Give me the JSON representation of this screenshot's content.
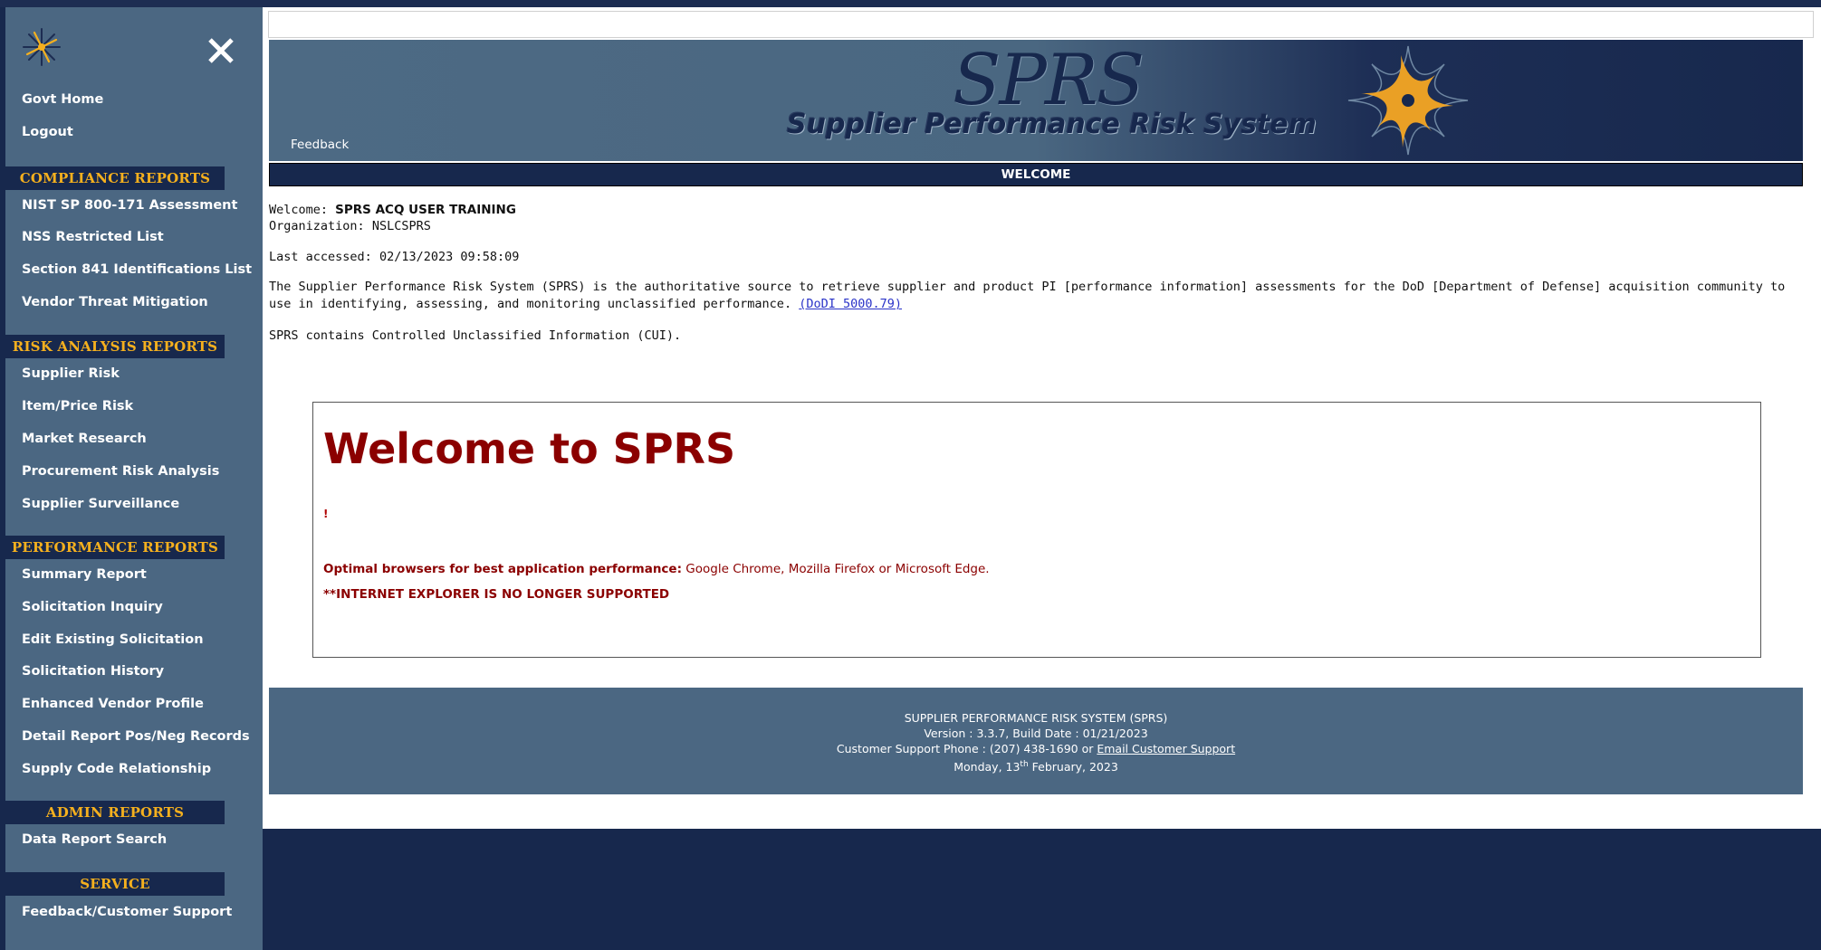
{
  "sidebar": {
    "top_links": [
      "Govt Home",
      "Logout"
    ],
    "sections": [
      {
        "heading": "COMPLIANCE REPORTS",
        "items": [
          "NIST SP 800-171 Assessment",
          "NSS Restricted List",
          "Section 841 Identifications List",
          "Vendor Threat Mitigation"
        ]
      },
      {
        "heading": "RISK ANALYSIS REPORTS",
        "items": [
          "Supplier Risk",
          "Item/Price Risk",
          "Market Research",
          "Procurement Risk Analysis",
          "Supplier Surveillance"
        ]
      },
      {
        "heading": "PERFORMANCE REPORTS",
        "items": [
          "Summary Report",
          "Solicitation Inquiry",
          "Edit Existing Solicitation",
          "Solicitation History",
          "Enhanced Vendor Profile",
          "Detail Report Pos/Neg Records",
          "Supply Code Relationship"
        ]
      },
      {
        "heading": "ADMIN REPORTS",
        "items": [
          "Data Report Search"
        ]
      },
      {
        "heading": "SERVICE",
        "items": [
          "Feedback/Customer Support"
        ]
      }
    ]
  },
  "banner": {
    "feedback": "Feedback",
    "title": "SPRS",
    "subtitle": "Supplier Performance Risk System"
  },
  "welcome_bar": "WELCOME",
  "user": {
    "welcome_label": "Welcome:",
    "name": "SPRS ACQ USER  TRAINING",
    "org_label": "Organization:",
    "org": "NSLCSPRS",
    "last_label": "Last accessed:",
    "last_accessed": "02/13/2023 09:58:09"
  },
  "description": "The Supplier Performance Risk System (SPRS) is the authoritative source to retrieve supplier and product PI [performance information] assessments for the DoD [Department of Defense] acquisition community to use in identifying, assessing, and monitoring unclassified performance. ",
  "description_link": "(DoDI 5000.79)",
  "cui_notice": "SPRS contains Controlled Unclassified Information (CUI).",
  "welcome_box": {
    "heading": "Welcome to SPRS",
    "marker": "!",
    "browsers_label": "Optimal browsers for best application performance:",
    "browsers": " Google Chrome, Mozilla Firefox or Microsoft Edge.",
    "ie_notice": "**INTERNET EXPLORER IS NO LONGER SUPPORTED"
  },
  "footer": {
    "line1": "SUPPLIER PERFORMANCE RISK SYSTEM (SPRS)",
    "line2": "Version : 3.3.7, Build Date : 01/21/2023",
    "phone": "Customer Support Phone : (207) 438-1690 or ",
    "email_link": "Email Customer Support",
    "date_pre": "Monday, 13",
    "date_sup": "th",
    "date_post": " February, 2023"
  },
  "colors": {
    "navy": "#17284d",
    "slate": "#4b6782",
    "gold": "#f5b01e",
    "maroon": "#8b0000"
  },
  "icons": {
    "logo": "star-logo-icon",
    "close": "close-icon"
  }
}
